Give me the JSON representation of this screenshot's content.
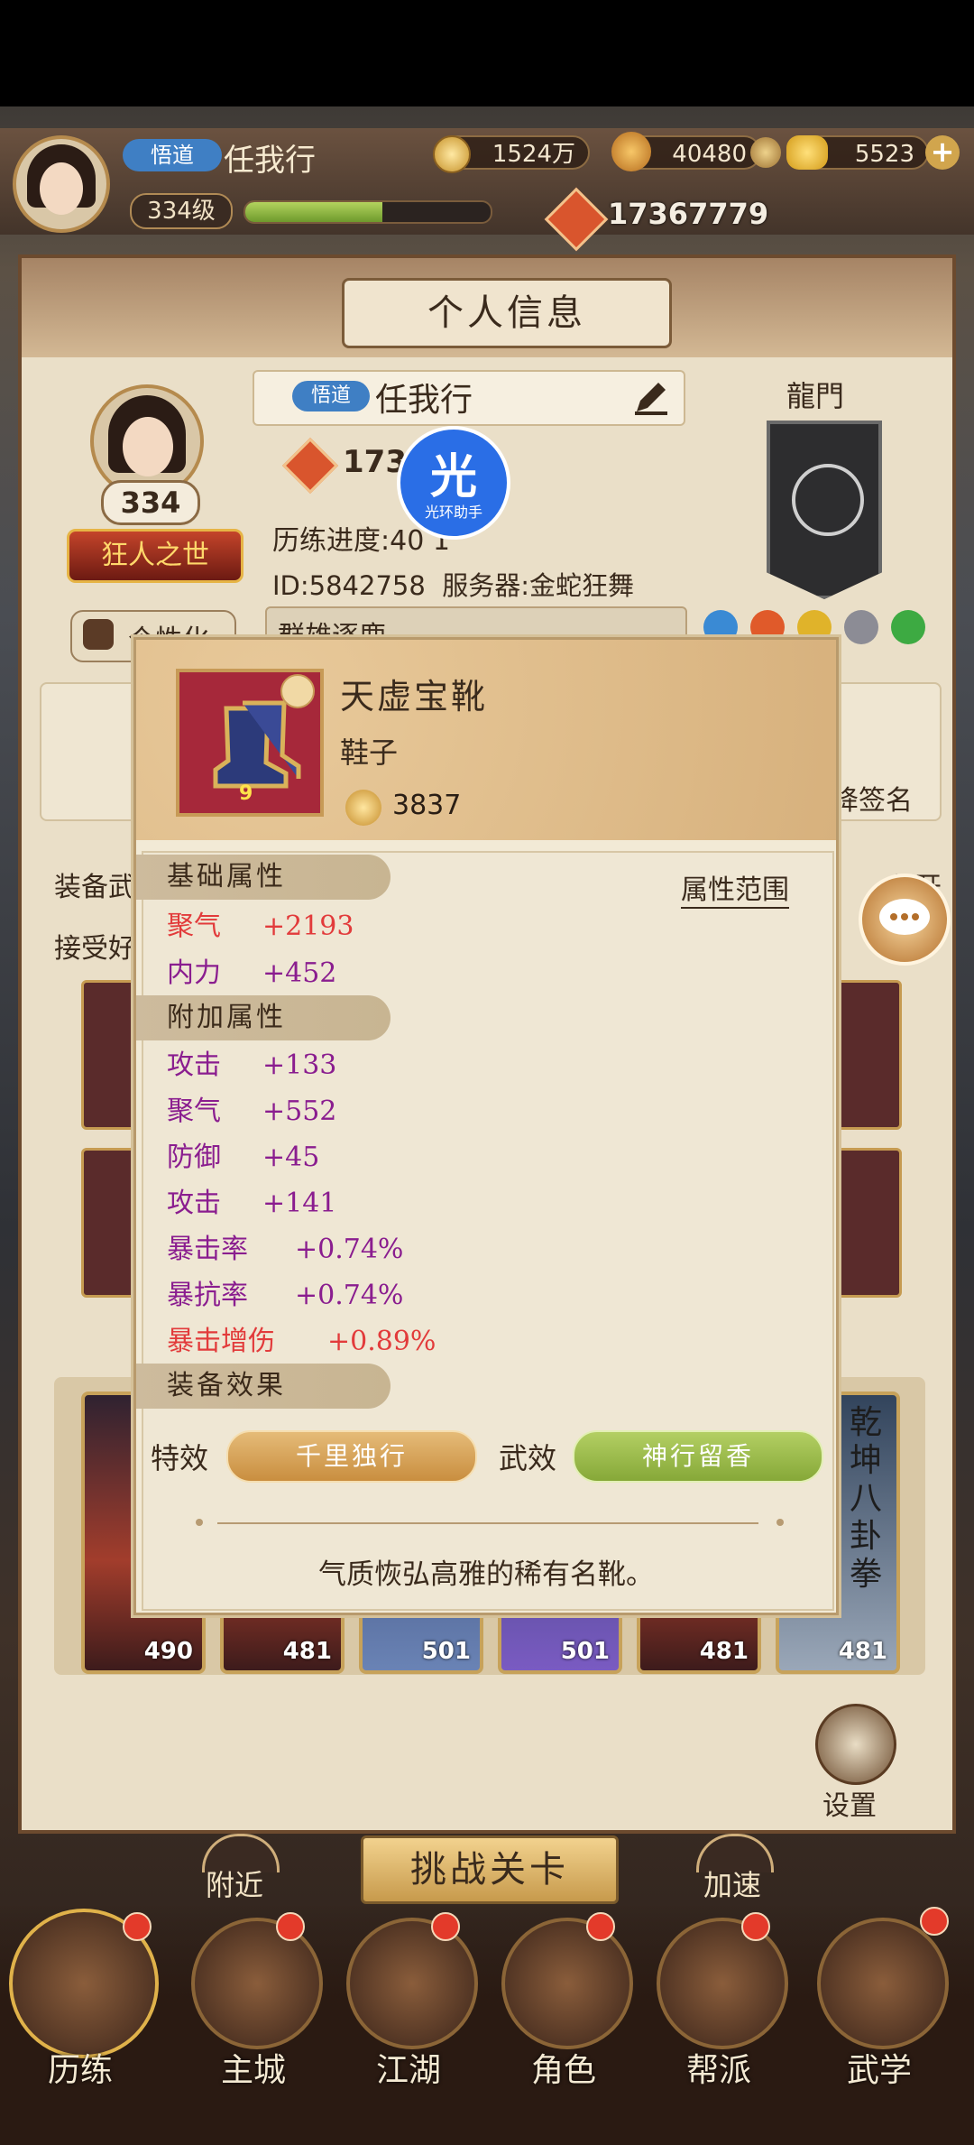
{
  "header": {
    "title_tag": "悟道",
    "player_name": "任我行",
    "level": "334级",
    "level_progress": 0.56,
    "currency1": "1524万",
    "currency2": "40480",
    "currency3": "5523",
    "power": "17367779"
  },
  "panel": {
    "title": "个人信息",
    "avatar_level": "334",
    "title_badge": "狂人之世",
    "name_tag": "悟道",
    "name": "任我行",
    "power_partial": "173",
    "progress_label": "历练进度:40 1",
    "id_server": "ID:5842758  服务器:金蛇狂舞",
    "customize": "个性化",
    "group_text": "群雄逐鹿",
    "faction_label": "龍門",
    "left_rows": [
      "装备武",
      "接受好"
    ],
    "right_rows": [
      "公开",
      "名"
    ],
    "sign_label": "降签名",
    "hero_numbers": [
      "490",
      "481",
      "501",
      "501",
      "481",
      "481"
    ],
    "hero_side_text": "乾坤八卦拳",
    "settings": "设置"
  },
  "watermark": {
    "text": "光环助手",
    "glyph": "光"
  },
  "popup": {
    "item_name": "天虚宝靴",
    "item_type": "鞋子",
    "item_score": "3837",
    "item_level_badge": "9",
    "base_title": "基础属性",
    "range_label": "属性范围",
    "base_attrs": [
      {
        "name": "聚气",
        "value": "+2193",
        "color": "#e23b3b"
      },
      {
        "name": "内力",
        "value": "+452",
        "color": "#8a1d8f"
      }
    ],
    "extra_title": "附加属性",
    "extra_attrs": [
      {
        "name": "攻击",
        "value": "+133",
        "color": "#8a1d8f"
      },
      {
        "name": "聚气",
        "value": "+552",
        "color": "#8a1d8f"
      },
      {
        "name": "防御",
        "value": "+45",
        "color": "#8a1d8f"
      },
      {
        "name": "攻击",
        "value": "+141",
        "color": "#8a1d8f"
      },
      {
        "name": "暴击率",
        "value": "+0.74%",
        "color": "#8a1d8f"
      },
      {
        "name": "暴抗率",
        "value": "+0.74%",
        "color": "#8a1d8f"
      },
      {
        "name": "暴击增伤",
        "value": "+0.89%",
        "color": "#e23b3b"
      }
    ],
    "effect_title": "装备效果",
    "special_label": "特效",
    "special_value": "千里独行",
    "martial_label": "武效",
    "martial_value": "神行留香",
    "description": "气质恢弘高雅的稀有名靴。"
  },
  "bottom": {
    "challenge": "挑战关卡",
    "nearby": "附近",
    "speedup": "加速",
    "nav": [
      "历练",
      "主城",
      "江湖",
      "角色",
      "帮派",
      "武学"
    ]
  }
}
